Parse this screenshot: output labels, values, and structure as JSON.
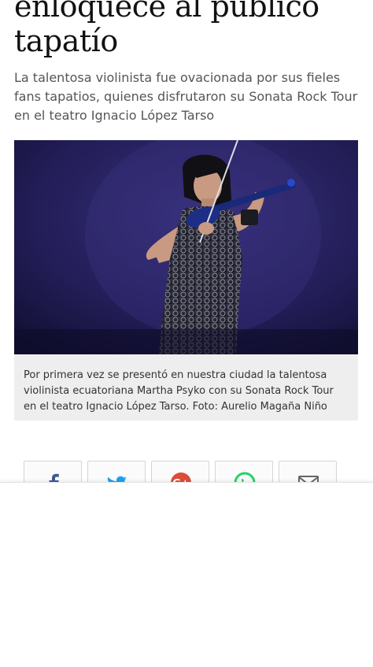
{
  "article": {
    "headline_line1": "enloquece al público",
    "headline_line2": "tapatío",
    "subhead": "La talentosa violinista fue ovacionada por sus fieles fans tapatios, quienes disfrutaron su Sonata Rock Tour en el teatro Ignacio López Tarso",
    "caption": "Por primera vez se presentó en nuestra ciudad la talentosa violinista ecuatoriana Martha Psyko con su Sonata Rock Tour en el teatro Ignacio López Tarso. Foto: Aurelio Magaña Niño"
  },
  "photo": {
    "subject": "violinist performing on stage"
  },
  "share": {
    "buttons": [
      {
        "icon": "facebook-icon",
        "color": "#3b5998"
      },
      {
        "icon": "twitter-icon",
        "color": "#1da1f2"
      },
      {
        "icon": "google-plus-icon",
        "color": "#dd4b39"
      },
      {
        "icon": "whatsapp-icon",
        "color": "#25d366"
      },
      {
        "icon": "email-icon",
        "color": "#666666"
      }
    ]
  }
}
